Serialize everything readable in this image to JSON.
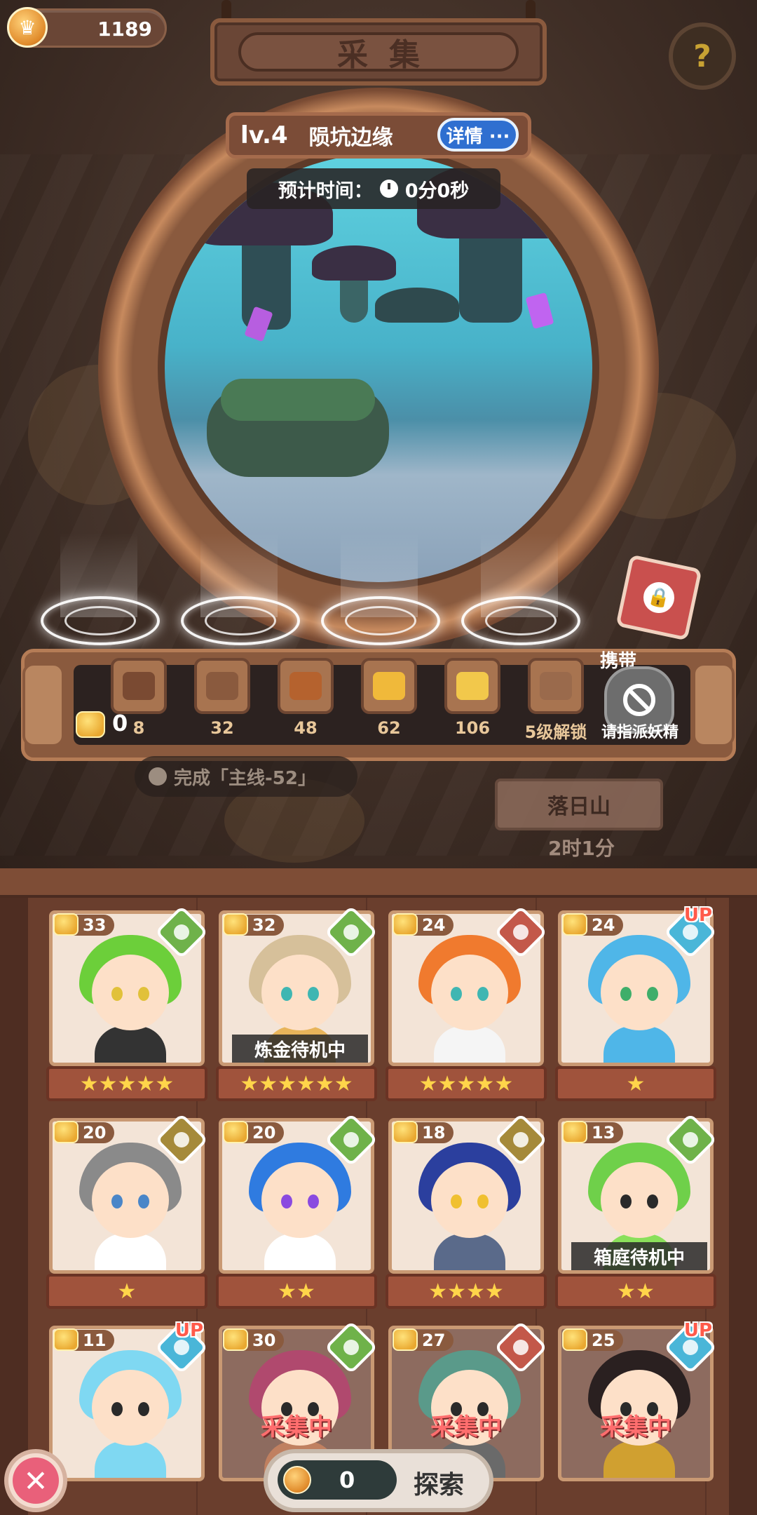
{
  "header": {
    "coin_value": "1189",
    "coin_icon": "crown-coin-icon",
    "title": "采集",
    "help_icon": "question-mark-icon"
  },
  "stage": {
    "level": "lv.4",
    "name": "陨坑边缘",
    "detail_label": "详情 ···",
    "time_label": "预计时间：",
    "time_value": "0分0秒"
  },
  "rewards": {
    "count": "0",
    "slots": [
      {
        "num": "8",
        "color": "#7a4a32"
      },
      {
        "num": "32",
        "color": "#8a5a3e"
      },
      {
        "num": "48",
        "color": "#b5622e"
      },
      {
        "num": "62",
        "color": "#f0b93a"
      },
      {
        "num": "106",
        "color": "#f2c84b"
      },
      {
        "num": "5级解锁",
        "color": "#9a6a4c"
      }
    ],
    "carry_label": "携带",
    "carry_hint": "请指派妖精"
  },
  "quest": {
    "lock_text": "完成「主线-52」",
    "mountain_name": "落日山",
    "mountain_time": "2时1分"
  },
  "cards": [
    {
      "level": "33",
      "element": "#6fb24a",
      "hair": "#6ccf3a",
      "body": "#333333",
      "eye": "#e1c13a",
      "stars": "★★★★★",
      "status": "",
      "busy": false,
      "up": ""
    },
    {
      "level": "32",
      "element": "#6fb24a",
      "hair": "#d6c09a",
      "body": "#e8b45a",
      "eye": "#3fb6b2",
      "stars": "★★★★★★",
      "status": "炼金待机中",
      "busy": false,
      "up": ""
    },
    {
      "level": "24",
      "element": "#c3584a",
      "hair": "#f07a2e",
      "body": "#f5f5f5",
      "eye": "#3fb6b2",
      "stars": "★★★★★",
      "status": "",
      "busy": false,
      "up": ""
    },
    {
      "level": "24",
      "element": "#4ab6d8",
      "hair": "#4fb6e8",
      "body": "#4fb6e8",
      "eye": "#3fae6a",
      "stars": "★",
      "status": "",
      "busy": false,
      "up": "UP"
    },
    {
      "level": "20",
      "element": "#a58a3a",
      "hair": "#8a8a8a",
      "body": "#ffffff",
      "eye": "#4a86c8",
      "stars": "★",
      "status": "",
      "busy": false,
      "up": ""
    },
    {
      "level": "20",
      "element": "#6fb24a",
      "hair": "#2f7be0",
      "body": "#ffffff",
      "eye": "#8a4ae0",
      "stars": "★★",
      "status": "",
      "busy": false,
      "up": ""
    },
    {
      "level": "18",
      "element": "#a58a3a",
      "hair": "#2b3f9e",
      "body": "#5a6a8a",
      "eye": "#f0c030",
      "stars": "★★★★",
      "status": "",
      "busy": false,
      "up": ""
    },
    {
      "level": "13",
      "element": "#6fb24a",
      "hair": "#6fd04a",
      "body": "#8ae05a",
      "eye": "#2a2a2a",
      "stars": "★★",
      "status": "箱庭待机中",
      "busy": false,
      "up": ""
    },
    {
      "level": "11",
      "element": "#4ab6d8",
      "hair": "#7fd8f2",
      "body": "#7fd8f2",
      "eye": "#2a2a2a",
      "stars": "",
      "status": "",
      "busy": false,
      "up": "UP"
    },
    {
      "level": "30",
      "element": "#6fb24a",
      "hair": "#b0496e",
      "body": "#c08060",
      "eye": "#2a2a2a",
      "stars": "",
      "status": "采集中",
      "busy": true,
      "up": ""
    },
    {
      "level": "27",
      "element": "#c3584a",
      "hair": "#5a9a8a",
      "body": "#6a6a6a",
      "eye": "#2a2a2a",
      "stars": "",
      "status": "采集中",
      "busy": true,
      "up": ""
    },
    {
      "level": "25",
      "element": "#4ab6d8",
      "hair": "#2a2020",
      "body": "#d0a030",
      "eye": "#2a2a2a",
      "stars": "",
      "status": "采集中",
      "busy": true,
      "up": "UP"
    }
  ],
  "footer": {
    "close_icon": "close-x-icon",
    "explore_cost": "0",
    "explore_label": "探索"
  }
}
